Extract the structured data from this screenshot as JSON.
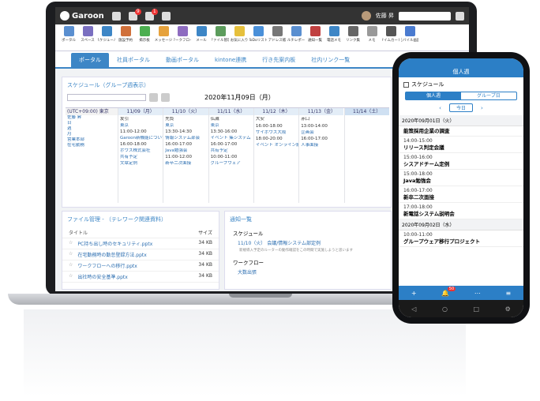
{
  "colors": {
    "accent": "#3d86c6",
    "topbar": "#333333",
    "phone_accent": "#2c7fc6"
  },
  "topbar": {
    "brand": "Garoon",
    "badges": [
      "9",
      "1"
    ],
    "user": "佐藤 昇"
  },
  "apps": [
    "ポータル",
    "スペース",
    "スケジュール",
    "施設予約",
    "掲示板",
    "メッセージ",
    "ワークフロー",
    "メール",
    "ファイル管理",
    "お気に入り",
    "ToDoリスト",
    "アドレス帳",
    "マルチレポート",
    "通知一覧",
    "電話メモ",
    "リンク集",
    "メモ",
    "タイムカード",
    "モバイル画面"
  ],
  "tabs": [
    "ポータル",
    "社員ポータル",
    "動画ポータル",
    "kintone連携",
    "行き先案内板",
    "社内リンク一覧"
  ],
  "schedule": {
    "title": "スケジュール（グループ週表示）",
    "date": "2020年11月09日（月）",
    "timezone": "(UTC+09:00) 東京",
    "days": [
      "11/09（月）",
      "11/10（火）",
      "11/11（水）",
      "11/12（木）",
      "11/13（金）",
      "11/14（土）"
    ],
    "members": [
      "佐藤 昇",
      "日",
      "週",
      "月",
      "営業本部",
      "在宅勤務"
    ],
    "cells": [
      [
        "友引",
        "東京",
        "11:00-12:00",
        "Garoon新機能について",
        "16:00-18:00",
        "ポウズ株式会社",
        "共有予定",
        "文章定例"
      ],
      [
        "先負",
        "東京",
        "13:30-14:30",
        "情報システム部会",
        "16:00-17:00",
        "Java勉強会",
        "11:00-12:00",
        "新卒二次面接"
      ],
      [
        "仏滅",
        "東京",
        "13:30-16:00",
        "イベント 集システム",
        "16:00-17:00",
        "共有予定",
        "10:00-11:00",
        "グループウェア"
      ],
      [
        "大安",
        "",
        "16:00-18:00",
        "サイボウズ大阪",
        "18:00-20:00",
        "イベント オンライン飲み"
      ],
      [
        "赤口",
        "",
        "13:00-14:00",
        "企画会",
        "16:00-17:00",
        "人事面接"
      ],
      [
        ""
      ]
    ]
  },
  "files": {
    "title": "ファイル管理 - （テレワーク関連資料）",
    "col_title": "タイトル",
    "col_size": "サイズ",
    "rows": [
      {
        "name": "PC持ち出し時のセキュリティ.pptx",
        "size": "34 KB"
      },
      {
        "name": "在宅勤務時の勤怠登録方法.pptx",
        "size": "34 KB"
      },
      {
        "name": "ワークフローへの移行.pptx",
        "size": "34 KB"
      },
      {
        "name": "出社時の安全基準.pptx",
        "size": "34 KB"
      }
    ]
  },
  "notify": {
    "title": "通知一覧",
    "sched": "スケジュール",
    "item": "11/10（火） 会議/情報システム部定例",
    "desc": "新規導入予定のルーターの動作確認をこの時間で実施しようと思います",
    "wf": "ワークフロー",
    "wf_item": "大数出張"
  },
  "phone": {
    "header": "個人週",
    "title": "スケジュール",
    "seg": [
      "個人週",
      "グループ日"
    ],
    "today": "今日",
    "days": [
      {
        "date": "2020年09月01日（火）",
        "events": [
          {
            "time": "",
            "name": "能策採用企業の調査"
          },
          {
            "time": "14:00-15:00",
            "name": "リリース判定会議"
          },
          {
            "time": "15:00-16:00",
            "name": "シスアドチーム定例"
          },
          {
            "time": "15:00-18:00",
            "name": "Java勉強会"
          },
          {
            "time": "16:00-17:00",
            "name": "新卒二次面接"
          },
          {
            "time": "17:00-18:00",
            "name": "新電話システム説明会"
          }
        ]
      },
      {
        "date": "2020年09月02日（水）",
        "events": [
          {
            "time": "10:00-11:00",
            "name": "グループウェア移行プロジェクト"
          }
        ]
      }
    ],
    "badge": "50"
  }
}
